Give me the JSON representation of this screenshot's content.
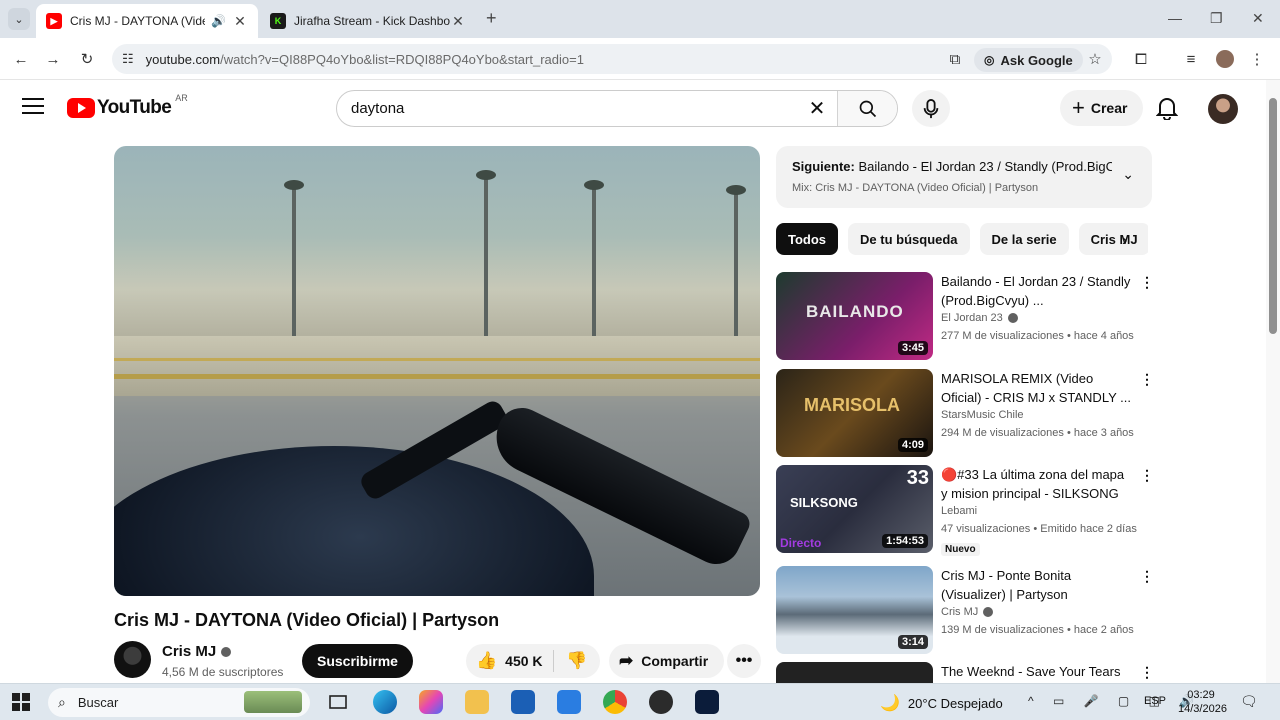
{
  "browser": {
    "tabs": [
      {
        "title": "Cris MJ - DAYTONA (Video Oficial) | Partyson",
        "active": true
      },
      {
        "title": "Jirafha Stream - Kick Dashboard",
        "active": false
      }
    ],
    "url_host": "youtube.com",
    "url_rest": "/watch?v=QI88PQ4oYbo&list=RDQI88PQ4oYbo&start_radio=1",
    "ask_google": "Ask Google"
  },
  "header": {
    "logo_text": "YouTube",
    "country_code": "AR",
    "search_value": "daytona",
    "create_label": "Crear"
  },
  "video": {
    "title": "Cris MJ - DAYTONA (Video Oficial) | Partyson",
    "channel": "Cris MJ",
    "subscribers": "4,56 M de suscriptores",
    "subscribe_label": "Suscribirme",
    "likes": "450 K",
    "share_label": "Compartir"
  },
  "up_next": {
    "label": "Siguiente:",
    "title": "Bailando - El Jordan 23 / Standly (Prod.BigCvyu)",
    "mix": "Mix: Cris MJ - DAYTONA (Video Oficial) | Partyson"
  },
  "chips": [
    "Todos",
    "De tu búsqueda",
    "De la serie",
    "Cris MJ"
  ],
  "recommendations": [
    {
      "title": "Bailando - El Jordan 23 / Standly (Prod.BigCvyu) ...",
      "channel": "El Jordan 23",
      "meta": "277 M de visualizaciones • hace 4 años",
      "duration": "3:45"
    },
    {
      "title": "MARISOLA REMIX (Video Oficial) - CRIS MJ x STANDLY ...",
      "channel": "StarsMusic Chile",
      "meta": "294 M de visualizaciones • hace 3 años",
      "duration": "4:09"
    },
    {
      "title": "🔴#33 La última zona del mapa y mision principal - SILKSONG",
      "channel": "Lebami",
      "meta": "47 visualizaciones • Emitido hace 2 días",
      "duration": "1:54:53",
      "badge": "Nuevo",
      "live_tag": "Directo"
    },
    {
      "title": "Cris MJ - Ponte Bonita (Visualizer) | Partyson",
      "channel": "Cris MJ",
      "meta": "139 M de visualizaciones • hace 2 años",
      "duration": "3:14"
    },
    {
      "title": "The Weeknd - Save Your Tears",
      "channel": "",
      "meta": "",
      "duration": ""
    }
  ],
  "taskbar": {
    "search_placeholder": "Buscar",
    "weather": "20°C  Despejado",
    "lang": "ESP",
    "time": "03:29",
    "date": "14/3/2026"
  }
}
